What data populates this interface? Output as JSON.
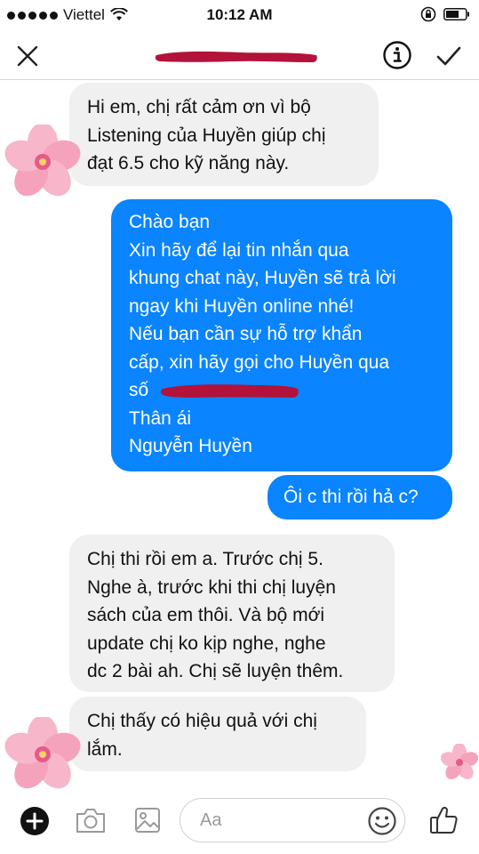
{
  "status_bar": {
    "carrier": "Viettel",
    "time": "10:12 AM"
  },
  "header": {
    "contact_name_redacted": true
  },
  "messages": [
    {
      "direction": "incoming",
      "lines": [
        "Hi em, chị rất cảm ơn vì bộ",
        "Listening của Huyền giúp chị",
        "đạt 6.5 cho kỹ năng này."
      ]
    },
    {
      "direction": "outgoing",
      "lines": [
        "Chào bạn",
        "Xin hãy để lại tin nhắn qua",
        "khung chat này, Huyền sẽ trả lời",
        "ngay khi Huyền online nhé!",
        "Nếu bạn cần sự hỗ trợ khẩn",
        "cấp, xin hãy gọi cho Huyền qua",
        "số",
        "Thân ái",
        "Nguyễn Huyền"
      ]
    },
    {
      "direction": "outgoing",
      "lines": [
        "Ôi c thi rồi hả c?"
      ]
    },
    {
      "direction": "incoming",
      "lines": [
        "Chị thi rồi em a. Trước chị 5.",
        "Nghe à, trước khi thi chị luyện",
        "sách của em thôi. Và bộ mới",
        "update chị ko kịp nghe, nghe",
        "dc 2 bài ah. Chị sẽ luyện thêm."
      ]
    },
    {
      "direction": "incoming",
      "lines": [
        "Chị thấy có hiệu quả với chị",
        "lắm."
      ]
    }
  ],
  "composer": {
    "placeholder": "Aa"
  },
  "colors": {
    "outgoing_bubble": "#0a84ff",
    "incoming_bubble": "#f0f0f0",
    "redaction": "#b3123a"
  },
  "icons": [
    "close-icon",
    "info-icon",
    "checkmark-icon",
    "plus-icon",
    "camera-icon",
    "photo-icon",
    "emoji-icon",
    "thumbs-up-icon",
    "wifi-icon",
    "battery-icon",
    "lock-rotation-icon"
  ]
}
